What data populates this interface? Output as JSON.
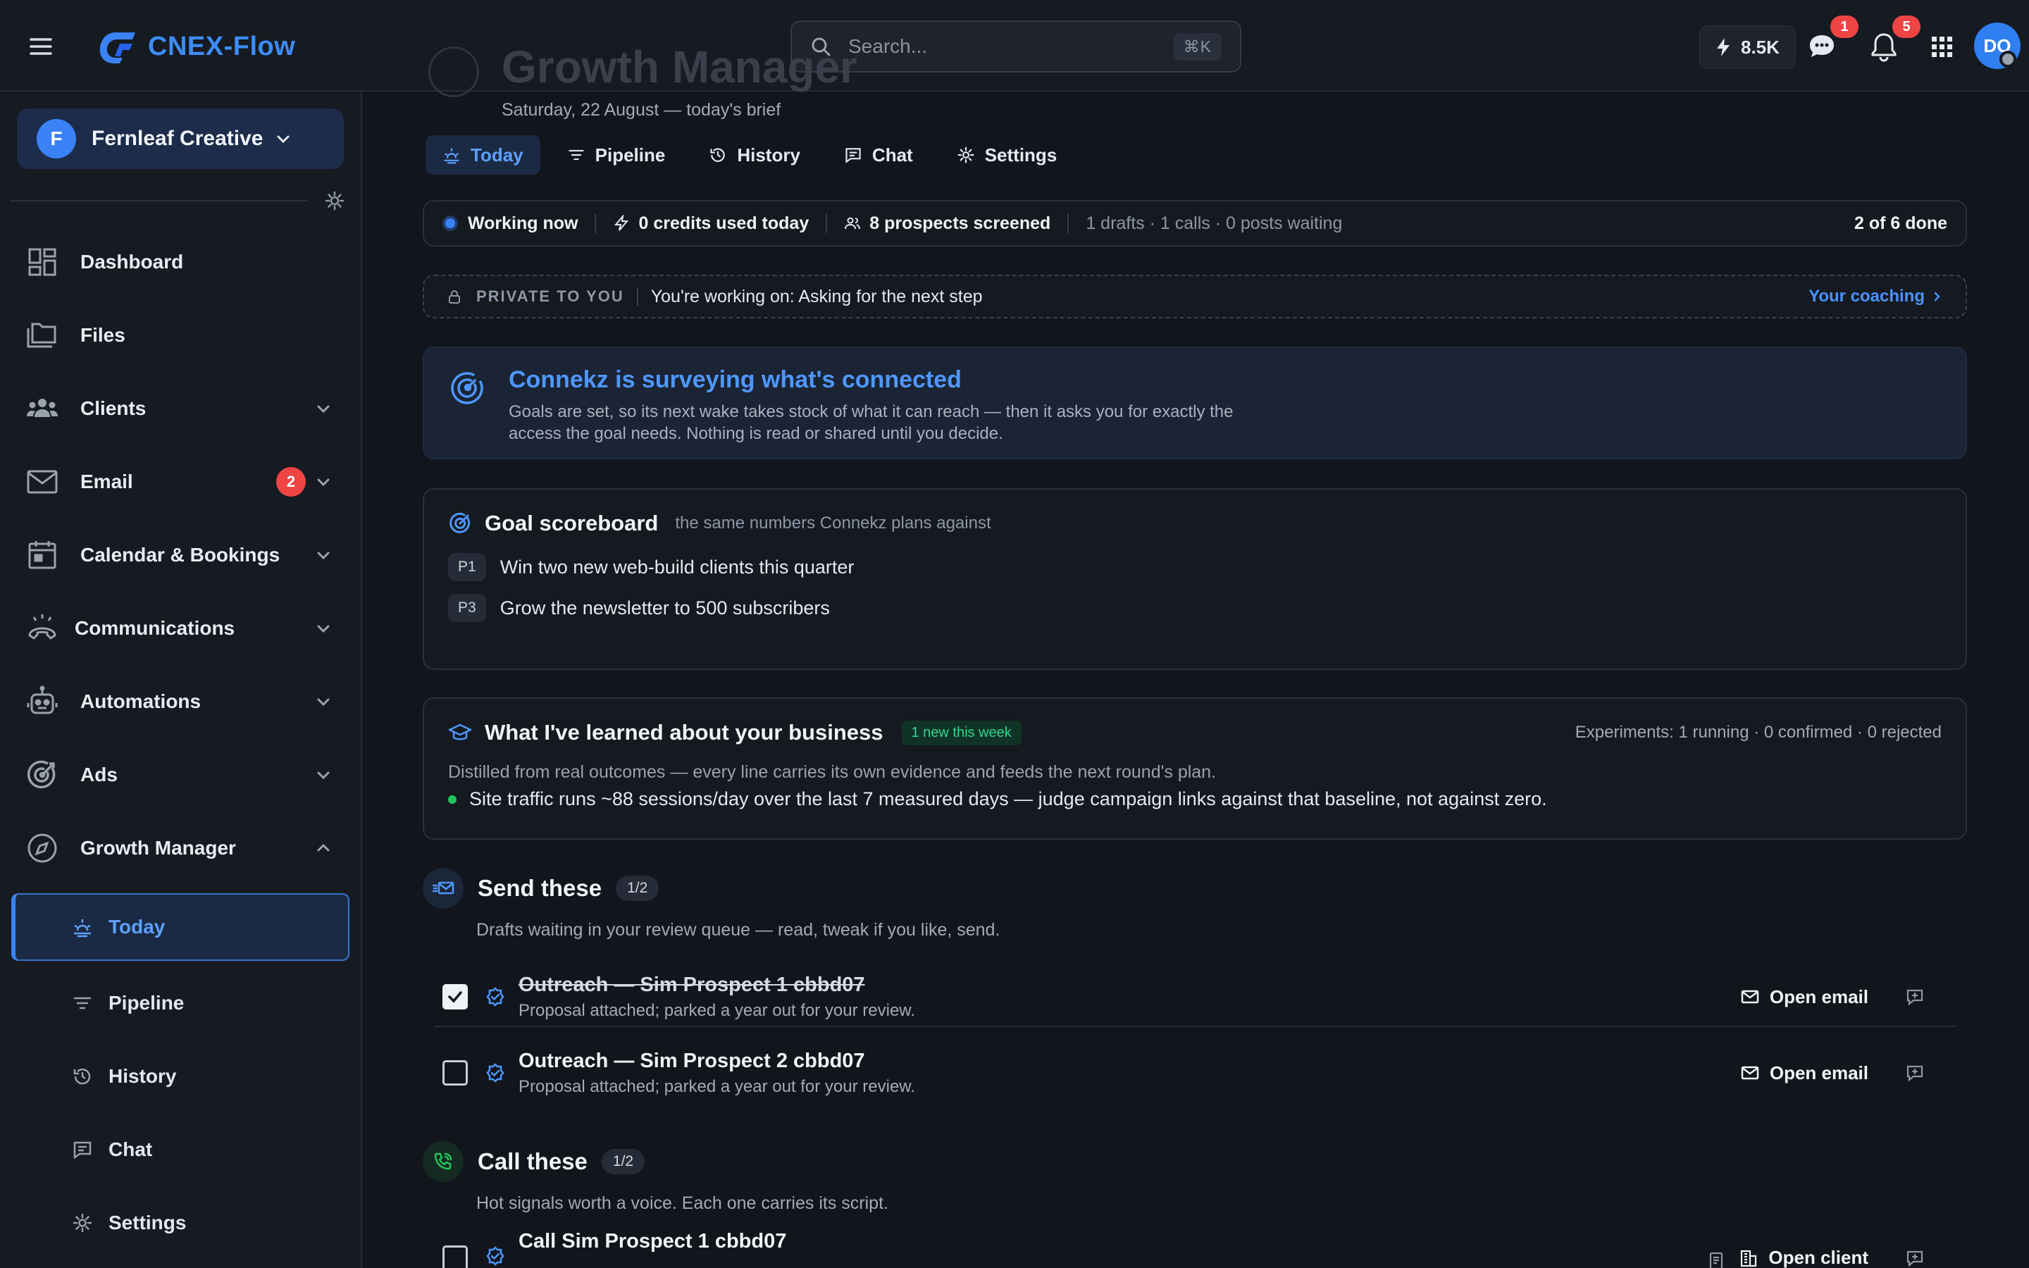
{
  "app": {
    "name": "CNEX-Flow"
  },
  "topbar": {
    "search_placeholder": "Search...",
    "search_shortcut": "⌘K",
    "credits": "8.5K",
    "chat_badge": "1",
    "notif_badge": "5",
    "avatar_initials": "DO"
  },
  "sidebar": {
    "workspace": {
      "initial": "F",
      "name": "Fernleaf Creative"
    },
    "items": [
      {
        "label": "Dashboard",
        "icon": "dashboard-icon"
      },
      {
        "label": "Files",
        "icon": "files-icon"
      },
      {
        "label": "Clients",
        "icon": "clients-icon"
      },
      {
        "label": "Email",
        "icon": "email-icon",
        "badge": "2"
      },
      {
        "label": "Calendar & Bookings",
        "icon": "calendar-icon"
      },
      {
        "label": "Communications",
        "icon": "communications-icon"
      },
      {
        "label": "Automations",
        "icon": "automations-icon"
      },
      {
        "label": "Ads",
        "icon": "ads-icon"
      },
      {
        "label": "Growth Manager",
        "icon": "compass-icon"
      }
    ],
    "sub_items": [
      {
        "label": "Today",
        "icon": "today-icon",
        "active": true
      },
      {
        "label": "Pipeline",
        "icon": "filter-icon"
      },
      {
        "label": "History",
        "icon": "history-icon"
      },
      {
        "label": "Chat",
        "icon": "chat-icon"
      },
      {
        "label": "Settings",
        "icon": "gear-icon"
      }
    ]
  },
  "page": {
    "title": "Growth Manager",
    "subtitle": "Saturday, 22 August — today's brief",
    "tabs": [
      "Today",
      "Pipeline",
      "History",
      "Chat",
      "Settings"
    ]
  },
  "status": {
    "working": "Working now",
    "credits": "0 credits used today",
    "prospects": "8 prospects screened",
    "queue": "1 drafts · 1 calls · 0 posts waiting",
    "progress": "2 of 6 done"
  },
  "private": {
    "tag": "PRIVATE TO YOU",
    "text": "You're working on: Asking for the next step",
    "link": "Your coaching"
  },
  "survey": {
    "title": "Connekz is surveying what's connected",
    "body": "Goals are set, so its next wake takes stock of what it can reach — then it asks you for exactly the access the goal needs. Nothing is read or shared until you decide."
  },
  "goals": {
    "title": "Goal scoreboard",
    "hint": "the same numbers Connekz plans against",
    "items": [
      {
        "tag": "P1",
        "text": "Win two new web-build clients this quarter"
      },
      {
        "tag": "P3",
        "text": "Grow the newsletter to 500 subscribers"
      }
    ]
  },
  "learned": {
    "title": "What I've learned about your business",
    "pill": "1 new this week",
    "experiments": "Experiments: 1 running · 0 confirmed · 0 rejected",
    "sub": "Distilled from real outcomes — every line carries its own evidence and feeds the next round's plan.",
    "item": "Site traffic runs ~88 sessions/day over the last 7 measured days — judge campaign links against that baseline, not against zero."
  },
  "send": {
    "title": "Send these",
    "count": "1/2",
    "sub": "Drafts waiting in your review queue — read, tweak if you like, send.",
    "tasks": [
      {
        "title": "Outreach — Sim Prospect 1 cbbd07",
        "sub": "Proposal attached; parked a year out for your review.",
        "action": "Open email",
        "done": true
      },
      {
        "title": "Outreach — Sim Prospect 2 cbbd07",
        "sub": "Proposal attached; parked a year out for your review.",
        "action": "Open email",
        "done": false
      }
    ]
  },
  "call": {
    "title": "Call these",
    "count": "1/2",
    "sub": "Hot signals worth a voice. Each one carries its script.",
    "tasks": [
      {
        "title": "Call Sim Prospect 1 cbbd07",
        "action": "Open client",
        "done": false
      }
    ]
  },
  "colors": {
    "accent": "#3b82f6",
    "badge": "#ef4444",
    "success": "#22c55e"
  }
}
